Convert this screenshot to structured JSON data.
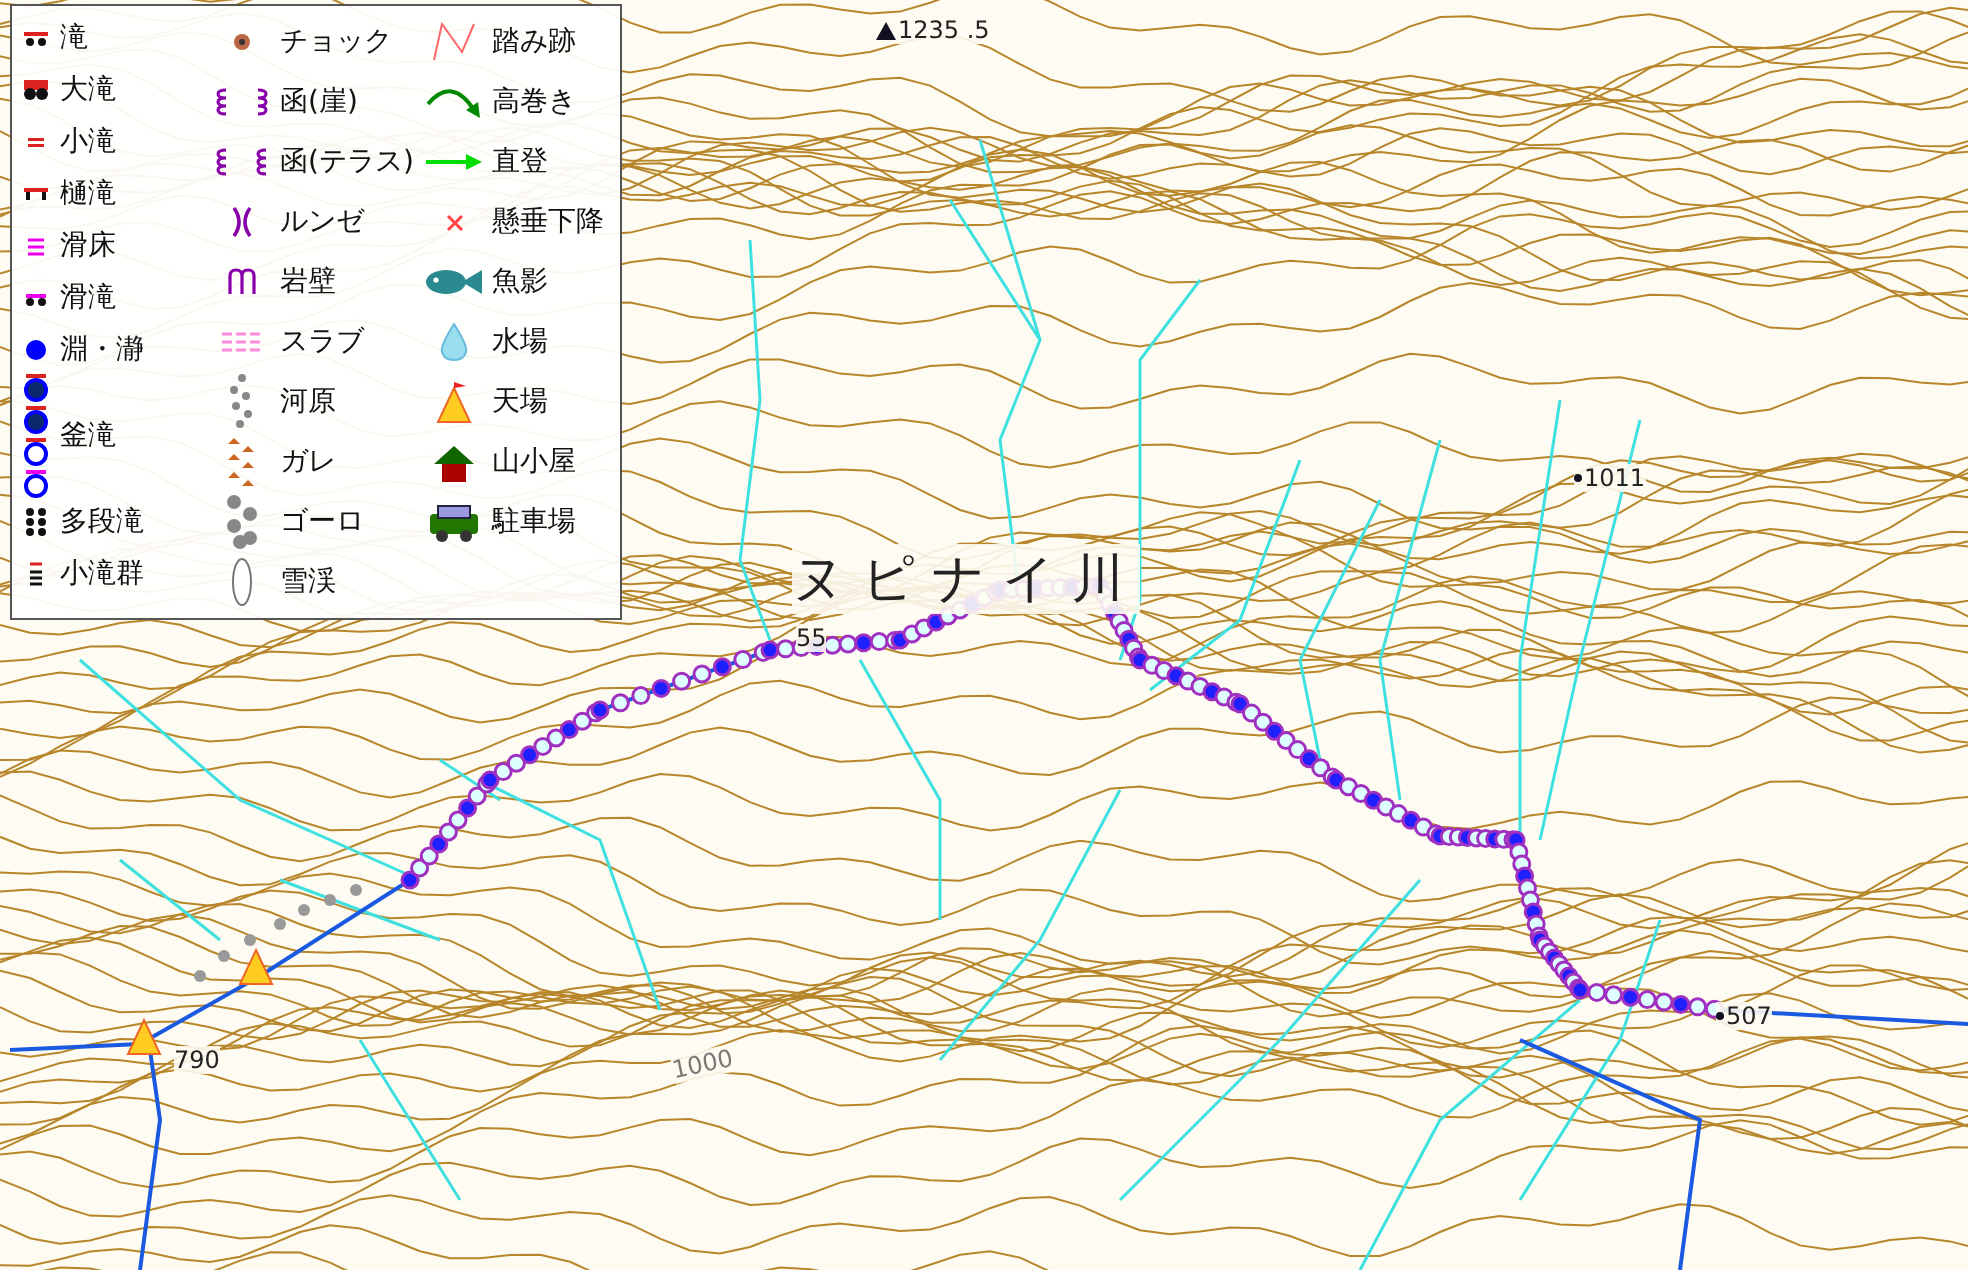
{
  "legend": {
    "columns": [
      [
        {
          "kind": "fall",
          "label": "滝"
        },
        {
          "kind": "big_fall",
          "label": "大滝"
        },
        {
          "kind": "small_fall",
          "label": "小滝"
        },
        {
          "kind": "gutter_fall",
          "label": "樋滝"
        },
        {
          "kind": "slide_bed",
          "label": "滑床"
        },
        {
          "kind": "slide_fall",
          "label": "滑滝"
        },
        {
          "kind": "pool",
          "label": "淵・瀞"
        },
        {
          "kind": "pot_fall",
          "label": "釜滝"
        },
        {
          "kind": "multi_fall",
          "label": "多段滝"
        },
        {
          "kind": "small_falls",
          "label": "小滝群"
        }
      ],
      [
        {
          "kind": "chock",
          "label": "チョック"
        },
        {
          "kind": "gorge_cliff",
          "label": "函(崖)"
        },
        {
          "kind": "gorge_terrace",
          "label": "函(テラス)"
        },
        {
          "kind": "gully",
          "label": "ルンゼ"
        },
        {
          "kind": "rock_wall",
          "label": "岩壁"
        },
        {
          "kind": "slab",
          "label": "スラブ"
        },
        {
          "kind": "riverbed",
          "label": "河原"
        },
        {
          "kind": "scree",
          "label": "ガレ"
        },
        {
          "kind": "boulders",
          "label": "ゴーロ"
        },
        {
          "kind": "snow",
          "label": "雪渓"
        }
      ],
      [
        {
          "kind": "trail",
          "label": "踏み跡"
        },
        {
          "kind": "detour",
          "label": "高巻き"
        },
        {
          "kind": "climb",
          "label": "直登"
        },
        {
          "kind": "rappel",
          "label": "懸垂下降"
        },
        {
          "kind": "fish",
          "label": "魚影"
        },
        {
          "kind": "water",
          "label": "水場"
        },
        {
          "kind": "camp",
          "label": "天場"
        },
        {
          "kind": "hut",
          "label": "山小屋"
        },
        {
          "kind": "parking",
          "label": "駐車場"
        }
      ]
    ]
  },
  "map": {
    "labels": [
      {
        "kind": "summit",
        "text": "1235 .5"
      },
      {
        "kind": "spot_height",
        "text": "1011"
      },
      {
        "kind": "river_name",
        "text": "ヌピナイ川"
      },
      {
        "kind": "plain",
        "text": "55"
      },
      {
        "kind": "spot_height",
        "text": "507"
      },
      {
        "kind": "plain",
        "text": "790"
      },
      {
        "kind": "contour",
        "text": "1000"
      }
    ]
  }
}
